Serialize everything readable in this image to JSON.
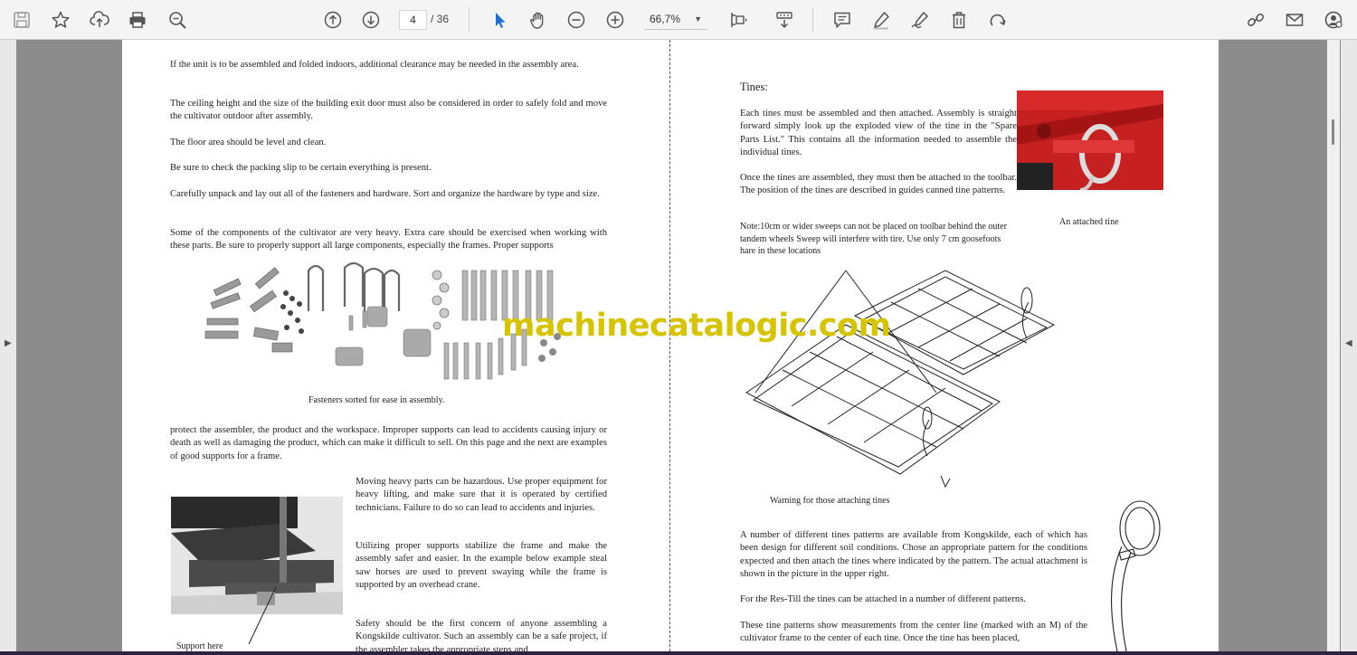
{
  "toolbar": {
    "page_current": "4",
    "page_total": "/ 36",
    "zoom": "66,7%",
    "icons": [
      "save-icon",
      "bookmark-star-icon",
      "upload-icon",
      "print-icon",
      "zoom-search-icon",
      "page-up-icon",
      "page-down-icon",
      "select-cursor-icon",
      "hand-icon",
      "zoom-out-icon",
      "zoom-in-icon",
      "fit-page-icon",
      "scroll-mode-icon",
      "comment-icon",
      "highlight-pen-icon",
      "sign-icon",
      "delete-icon",
      "rotate-icon",
      "share-link-icon",
      "mail-icon",
      "account-icon"
    ]
  },
  "document": {
    "left": {
      "p1": "If the unit is to be assembled and folded indoors, additional clearance may be needed in the assembly area.",
      "p2": "The ceiling height and the size of the building exit door must also be considered in order to safely fold and move the cultivator outdoor after assembly.",
      "p3": "The floor area should be level and clean.",
      "p4": "Be sure to check the packing slip to be certain everything is present.",
      "p5": "Carefully unpack and lay out all of the fasteners and hardware.    Sort and organize the hardware by type and size.",
      "p6": "Some of the components of the cultivator are very heavy. Extra care should be exercised when working with these parts. Be sure to properly support all large components, especially the frames. Proper supports",
      "fasteners_caption": "Fasteners sorted for ease in assembly.",
      "p7": "protect the assembler, the product and the workspace. Improper supports can lead to accidents causing injury or death as well as damaging the product, which can make it difficult to sell. On this page and the next are examples of good supports for a frame.",
      "p8": "Moving heavy parts can be hazardous. Use proper equipment for heavy lifting, and make sure that it is operated by certified technicians. Failure to do so can lead to accidents and injuries.",
      "p9": "Utilizing proper supports stabilize the frame and make the assembly safer and easier. In the example below example steal saw horses are used to prevent swaying while the frame is supported by an overhead crane.",
      "p10": "Safety should be the first concern of anyone assembling a Kongskilde cultivator. Such an assembly can be a safe project, if the assembler takes the appropriate steps and",
      "support_caption": "Support here"
    },
    "right": {
      "heading": "Tines:",
      "p1": "Each tines must be assembled and then attached. Assembly is straight forward simply look up the exploded view of the tine in the \"Spare Parts List.\" This contains all the information needed to assemble the individual tines.",
      "p2": "Once the tines are assembled, they must then be attached to the toolbar. The position of the tines are described in guides canned tine patterns.",
      "note": "Note:10cm or wider sweeps can not be placed on toolbar behind the outer tandem wheels  Sweep will interfere with tire. Use only 7 cm goosefoots hare in these locations",
      "tine_caption": "An attached tine",
      "warning_caption": "Warning for those attaching tines",
      "p3": "A number of different tines patterns are available from Kongskilde, each of which has been design for different soil conditions. Chose an appropriate pattern for the conditions expected and then attach the tines where indicated by the pattern. The actual attachment is shown in the picture in the upper right.",
      "p4": "For the Res-Till the tines can be attached in a number of different patterns.",
      "p5": "These tine patterns show measurements from the center line (marked with an M) of the cultivator frame to the center of each tine. Once the tine has been placed,"
    },
    "watermark": "machinecatalogic.com"
  }
}
